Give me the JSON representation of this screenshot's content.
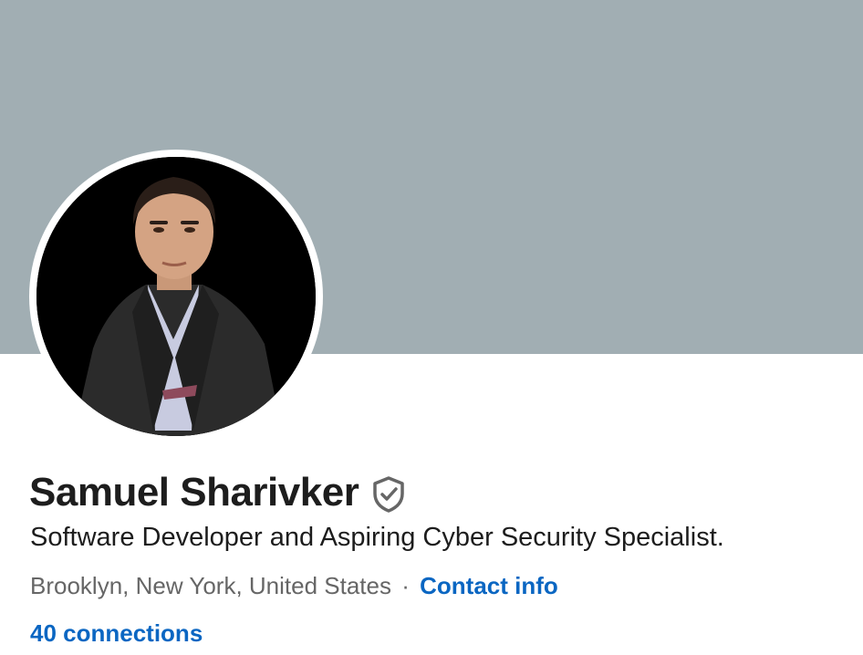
{
  "profile": {
    "name": "Samuel Sharivker",
    "verified_icon": "shield-check-icon",
    "headline": "Software Developer and Aspiring Cyber Security Specialist.",
    "location": "Brooklyn, New York, United States",
    "separator": "·",
    "contact_info_label": "Contact info",
    "connections_label": "40 connections"
  },
  "colors": {
    "banner": "#a1aeb3",
    "link": "#0a66c2",
    "name_text": "#1d1d1d",
    "secondary_text": "#666666",
    "avatar_background": "#000000"
  }
}
